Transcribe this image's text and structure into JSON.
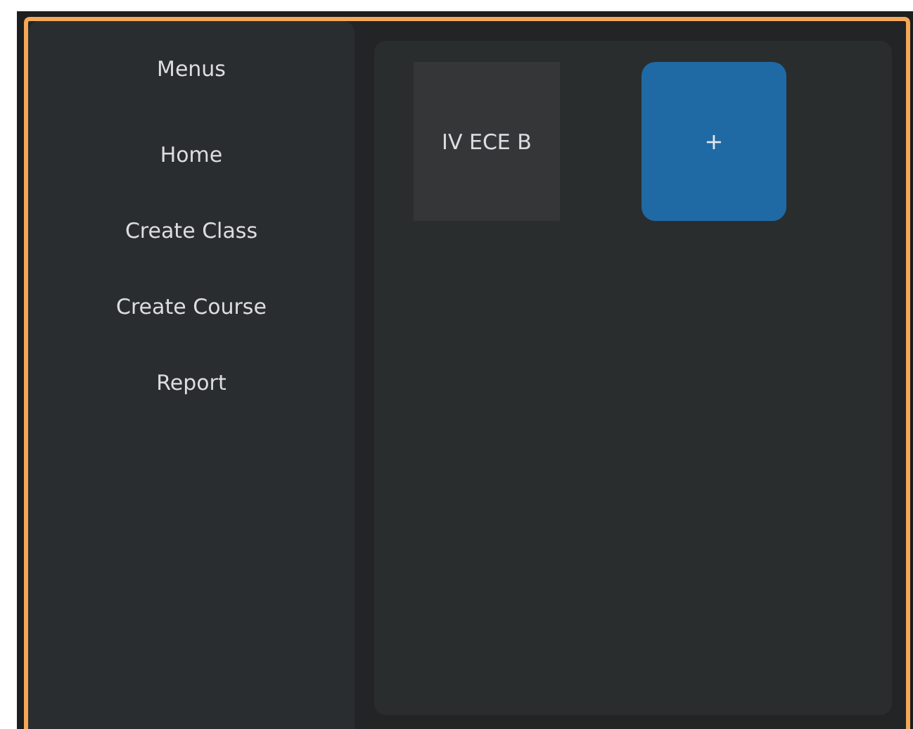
{
  "sidebar": {
    "title": "Menus",
    "items": [
      {
        "label": "Home"
      },
      {
        "label": "Create Class"
      },
      {
        "label": "Create Course"
      },
      {
        "label": "Report"
      }
    ]
  },
  "classes": [
    {
      "label": "IV ECE B"
    }
  ],
  "add_button": {
    "label": "+"
  }
}
